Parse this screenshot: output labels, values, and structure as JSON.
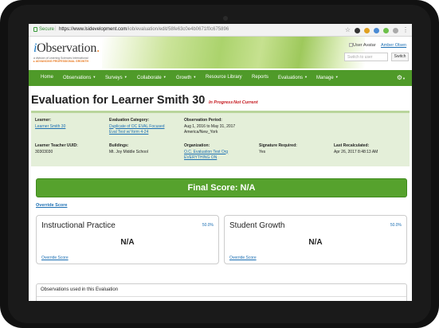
{
  "browser": {
    "secure_label": "Secure",
    "url_host": "https://www.lsidevelopment.com",
    "url_path": "/iob/evaluation/edit/58fe63c0e4b0671f0c675896"
  },
  "header": {
    "logo_i": "i",
    "logo_rest": "Observation",
    "logo_dot": ".",
    "tagline_1": "a division of Learning Sciences International",
    "tagline_2": "ADVANCING PROFESSIONAL GROWTH",
    "avatar_alt": "User Avatar",
    "username": "Amber Olsen",
    "switch_placeholder": "Switch to user",
    "switch_button": "Switch"
  },
  "nav": {
    "items": [
      "Home",
      "Observations",
      "Surveys",
      "Collaborate",
      "Growth",
      "Resource Library",
      "Reports",
      "Evaluations",
      "Manage"
    ]
  },
  "page": {
    "title": "Evaluation for Learner Smith 30",
    "status_1": "In Progress",
    "status_2": "Not Current"
  },
  "info": {
    "learner_label": "Learner:",
    "learner_value": "Learner Smith 30",
    "category_label": "Evaluation Category:",
    "category_value_1": "Duplicate of OC EVAL Focused",
    "category_value_2": "Eval Test w/ form 4-24",
    "period_label": "Observation Period:",
    "period_value_1": "Aug 1, 2016 to May 31, 2017",
    "period_value_2": "America/New_York",
    "uuid_label": "Learner Teacher UUID:",
    "uuid_value": "30303030",
    "buildings_label": "Buildings:",
    "buildings_value": "Mt. Joy Middle School",
    "org_label": "Organization:",
    "org_value_1": "O.C. Evaluation Test Org",
    "org_value_2": "EVERYTHING ON",
    "sig_label": "Signature Required:",
    "sig_value": "Yes",
    "recalc_label": "Last Recalculated:",
    "recalc_value": "Apr 26, 2017 8:48:13 AM"
  },
  "final": {
    "label": "Final Score: N/A",
    "override": "Override Score"
  },
  "cards": [
    {
      "title": "Instructional Practice",
      "weight": "50.0%",
      "score": "N/A",
      "override": "Override Score"
    },
    {
      "title": "Student Growth",
      "weight": "50.0%",
      "score": "N/A",
      "override": "Override Score"
    }
  ],
  "observations": {
    "title": "Observations used in this Evaluation"
  },
  "colors": {
    "nav_green": "#4f9a29",
    "final_green": "#56a22d",
    "link_blue": "#1c6fb3",
    "status_red": "#c4161c"
  }
}
